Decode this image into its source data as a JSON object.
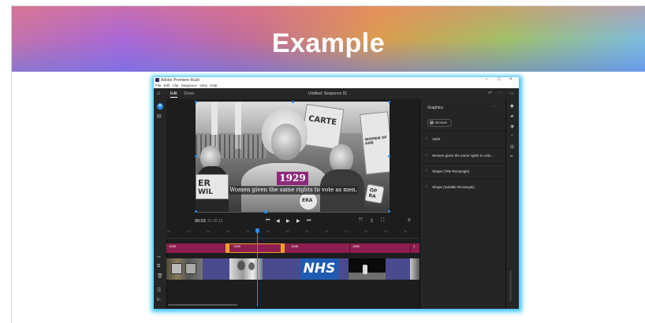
{
  "slide": {
    "title": "Example"
  },
  "window": {
    "app_title": "Adobe Premiere Rush",
    "controls": {
      "minimize": "−",
      "maximize": "□",
      "close": "×"
    }
  },
  "menu": [
    "File",
    "Edit",
    "Clip",
    "Sequence",
    "View",
    "Help"
  ],
  "topbar": {
    "tabs": [
      {
        "label": "Edit",
        "active": true
      },
      {
        "label": "Share",
        "active": false
      }
    ],
    "sequence_name": "Untitled: Sequence 01"
  },
  "video": {
    "year_title": "1929",
    "subtitle": "Women given the same rights to vote as men.",
    "sign_texts": [
      "CARTE",
      "ERA",
      "WOMEN OF AME",
      "ER",
      "WIL",
      "OP",
      "RA"
    ]
  },
  "transport": {
    "current_time": "00:03",
    "separator": "31",
    "total_time": "00:12"
  },
  "ruler_ticks": [
    "00",
    "03",
    "06",
    "09",
    "12",
    "15",
    "18",
    "21",
    "24",
    "27",
    "30",
    "33",
    "36"
  ],
  "title_track": {
    "clips": [
      "1928",
      "1929",
      "1948",
      "1969",
      "1"
    ]
  },
  "graphics_panel": {
    "title": "Graphics",
    "browse_label": "Browse",
    "items": [
      "1929",
      "Women given the same rights to vote...",
      "Shape (Title Rectangle)",
      "Shape (Subtitle Rectangle)"
    ]
  },
  "colors": {
    "title_track": "#8d1e4e",
    "video_track": "#4a4a8f",
    "accent": "#2d8ceb",
    "selection": "#f0a12a",
    "year_box": "#8c2a7a",
    "nhs_blue": "#1f5bb3"
  },
  "nhs_logo": "NHS"
}
